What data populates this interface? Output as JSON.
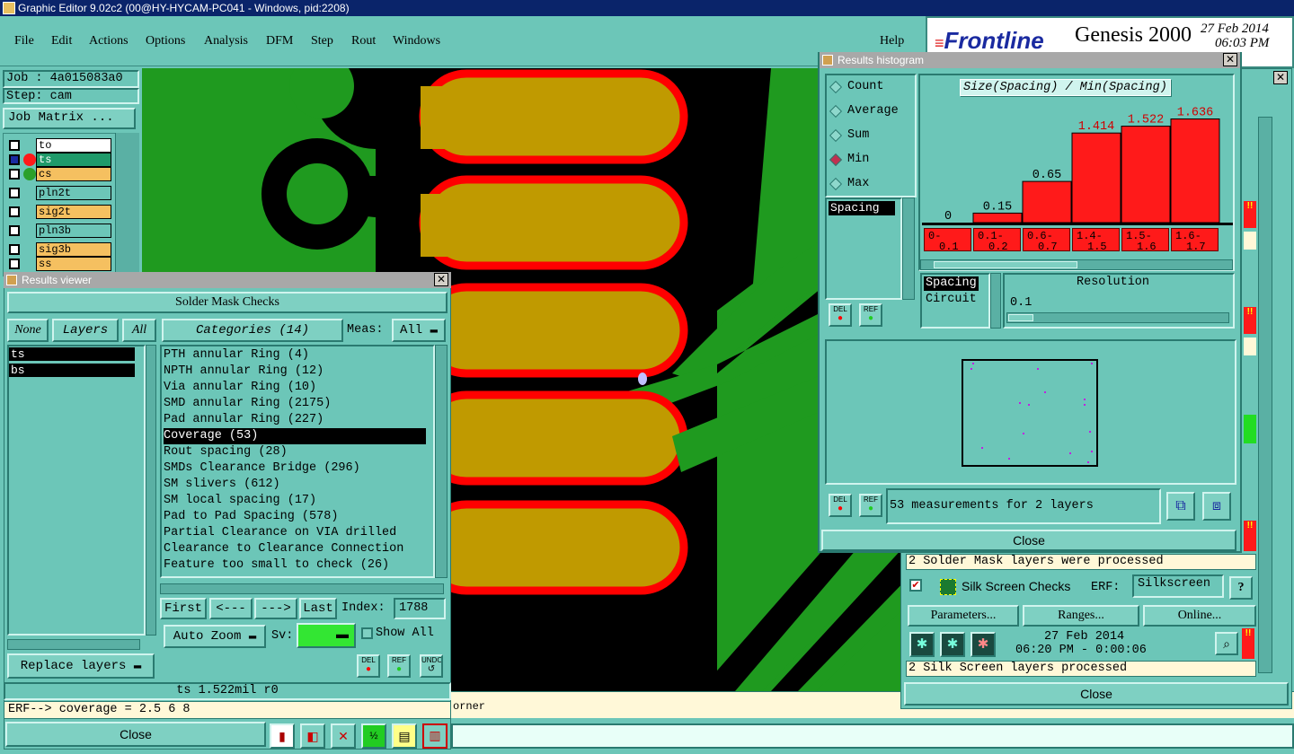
{
  "window_title": "Graphic Editor 9.02c2 (00@HY-HYCAM-PC041 - Windows, pid:2208)",
  "menu": [
    "File",
    "Edit",
    "Actions",
    "Options",
    "Analysis",
    "DFM",
    "Step",
    "Rout",
    "Windows"
  ],
  "help": "Help",
  "brand": {
    "logo": "Frontline",
    "product": "Genesis 2000",
    "date": "27 Feb 2014",
    "time": "06:03 PM"
  },
  "job": {
    "job": "Job : 4a015083a0",
    "step": "Step: cam",
    "matrix_button": "Job Matrix ..."
  },
  "layers": [
    {
      "name": "to",
      "bg": "#ffffff"
    },
    {
      "name": "ts",
      "bg": "#ffffff"
    },
    {
      "name": "cs",
      "bg": "#f5c060"
    },
    {
      "name": "pln2t",
      "bg": "#6cc6b8"
    },
    {
      "name": "sig2t",
      "bg": "#f5c060"
    },
    {
      "name": "pln3b",
      "bg": "#6cc6b8"
    },
    {
      "name": "sig3b",
      "bg": "#f5c060"
    },
    {
      "name": "ss",
      "bg": "#f5c060"
    }
  ],
  "results_viewer": {
    "title": "Results viewer",
    "header": "Solder Mask Checks",
    "none": "None",
    "layers_label": "Layers",
    "all": "All",
    "layer_list": [
      "ts",
      "bs"
    ],
    "categories_label": "Categories (14)",
    "meas_label": "Meas:",
    "meas_value": "All",
    "categories": [
      "PTH annular Ring (4)",
      "NPTH annular Ring (12)",
      "Via annular Ring (10)",
      "SMD annular Ring (2175)",
      "Pad annular Ring (227)",
      "Coverage (53)",
      "Rout spacing (28)",
      "SMDs Clearance Bridge (296)",
      "SM slivers (612)",
      "SM local spacing (17)",
      "Pad to Pad Spacing (578)",
      "Partial Clearance on VIA drilled",
      "Clearance to Clearance Connection",
      "Feature too small to check (26)"
    ],
    "first": "First",
    "prev": "<---",
    "next": "--->",
    "last": "Last",
    "index_label": "Index:",
    "index_value": "1788",
    "auto_zoom": "Auto Zoom",
    "sv_label": "Sv:",
    "show_all": "Show All",
    "replace_layers": "Replace layers",
    "del": "DEL",
    "ref": "REF",
    "undo": "UNDO",
    "status": "ts 1.522mil  r0",
    "erf": "ERF--> coverage = 2.5 6 8",
    "close": "Close"
  },
  "histogram": {
    "title": "Results histogram",
    "modes": [
      "Count",
      "Average",
      "Sum",
      "Min",
      "Max"
    ],
    "selected_mode": "Min",
    "list_item": "Spacing",
    "chart_title": "Size(Spacing) / Min(Spacing)",
    "resolution_label": "Resolution",
    "resolution_value": "0.1",
    "meas_types": [
      "Spacing",
      "Circuit"
    ],
    "summary": "53 measurements for 2 layers",
    "close": "Close",
    "del": "DEL",
    "ref": "REF"
  },
  "chart_data": {
    "type": "bar",
    "title": "Size(Spacing) / Min(Spacing)",
    "categories": [
      "0-0.1",
      "0.1-0.2",
      "0.6-0.7",
      "1.4-1.5",
      "1.5-1.6",
      "1.6-1.7"
    ],
    "values": [
      0,
      0.15,
      0.65,
      1.414,
      1.522,
      1.636
    ],
    "labels": [
      "0",
      "0.15",
      "0.65",
      "1.414",
      "1.522",
      "1.636"
    ]
  },
  "checks": {
    "solder_status": "2 Solder Mask layers were processed",
    "silk_name": "Silk Screen Checks",
    "erf_label": "ERF:",
    "erf_value": "Silkscreen",
    "help_q": "?",
    "parameters": "Parameters...",
    "ranges": "Ranges...",
    "online": "Online...",
    "date": "27 Feb 2014",
    "time": "06:20 PM - 0:00:06",
    "silk_status": "2 Silk Screen layers processed",
    "close": "Close"
  },
  "bottom_text": "orner",
  "colors": {
    "panel": "#6cc6b8",
    "board": "#1f9a1f",
    "copper": "#c09a00",
    "mask": "#ff0000",
    "titlebar": "#0a246a"
  }
}
